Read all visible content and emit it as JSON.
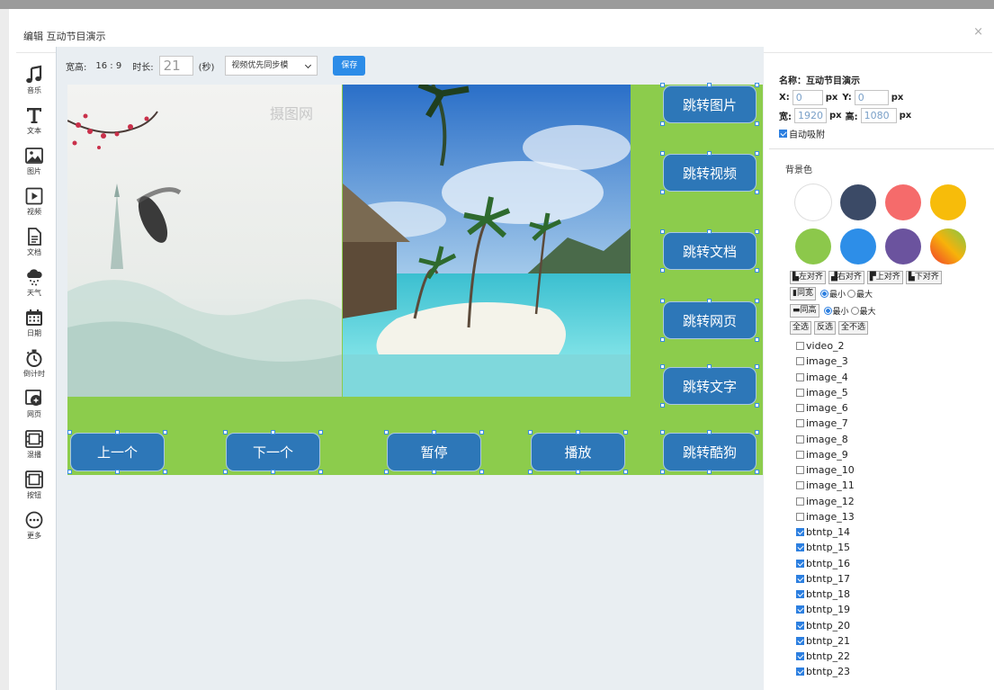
{
  "dialog": {
    "title": "编辑 互动节目演示",
    "close": "×"
  },
  "toolbox": [
    {
      "icon": "music-icon",
      "label": "音乐"
    },
    {
      "icon": "text-icon",
      "label": "文本"
    },
    {
      "icon": "image-icon",
      "label": "图片"
    },
    {
      "icon": "video-icon",
      "label": "视频"
    },
    {
      "icon": "document-icon",
      "label": "文档"
    },
    {
      "icon": "weather-icon",
      "label": "天气"
    },
    {
      "icon": "calendar-icon",
      "label": "日期"
    },
    {
      "icon": "countdown-icon",
      "label": "倒计时"
    },
    {
      "icon": "webpage-icon",
      "label": "网页"
    },
    {
      "icon": "carousel-icon",
      "label": "混播"
    },
    {
      "icon": "button-icon",
      "label": "按钮"
    },
    {
      "icon": "more-icon",
      "label": "更多"
    }
  ],
  "topbar": {
    "ratio_label": "宽高:",
    "ratio_value": "16 : 9",
    "duration_label": "时长:",
    "duration_value": "21",
    "duration_unit": "(秒)",
    "sync_mode": "视频优先同步模",
    "save": "保存"
  },
  "canvas": {
    "watermark": "摄图网",
    "buttons": {
      "goto_image": "跳转图片",
      "goto_video": "跳转视频",
      "goto_doc": "跳转文档",
      "goto_web": "跳转网页",
      "goto_text": "跳转文字",
      "goto_kugou": "跳转酷狗",
      "prev": "上一个",
      "next": "下一个",
      "pause": "暂停",
      "play": "播放"
    }
  },
  "props": {
    "name_label": "名称：",
    "name_value": "互动节目演示",
    "x_label": "X:",
    "x_value": "0",
    "y_label": "Y:",
    "y_value": "0",
    "unit": "px",
    "w_label": "宽:",
    "w_value": "1920",
    "h_label": "高:",
    "h_value": "1080",
    "auto_snap": "自动吸附",
    "bg_label": "背景色"
  },
  "colors": {
    "swatches": [
      "#ffffff",
      "#3b4a66",
      "#f56b6b",
      "#f7bc0a",
      "#8cc84b",
      "#2d8ee8",
      "#6b539e",
      "gradient"
    ]
  },
  "align": {
    "left": "左对齐",
    "right": "右对齐",
    "top": "上对齐",
    "bottom": "下对齐",
    "same_width": "同宽",
    "same_height": "同高",
    "min": "最小",
    "max": "最大",
    "select_all": "全选",
    "invert": "反选",
    "select_none": "全不选"
  },
  "layers": [
    {
      "name": "video_2",
      "checked": false
    },
    {
      "name": "image_3",
      "checked": false
    },
    {
      "name": "image_4",
      "checked": false
    },
    {
      "name": "image_5",
      "checked": false
    },
    {
      "name": "image_6",
      "checked": false
    },
    {
      "name": "image_7",
      "checked": false
    },
    {
      "name": "image_8",
      "checked": false
    },
    {
      "name": "image_9",
      "checked": false
    },
    {
      "name": "image_10",
      "checked": false
    },
    {
      "name": "image_11",
      "checked": false
    },
    {
      "name": "image_12",
      "checked": false
    },
    {
      "name": "image_13",
      "checked": false
    },
    {
      "name": "btntp_14",
      "checked": true
    },
    {
      "name": "btntp_15",
      "checked": true
    },
    {
      "name": "btntp_16",
      "checked": true
    },
    {
      "name": "btntp_17",
      "checked": true
    },
    {
      "name": "btntp_18",
      "checked": true
    },
    {
      "name": "btntp_19",
      "checked": true
    },
    {
      "name": "btntp_20",
      "checked": true
    },
    {
      "name": "btntp_21",
      "checked": true
    },
    {
      "name": "btntp_22",
      "checked": true
    },
    {
      "name": "btntp_23",
      "checked": true
    }
  ]
}
